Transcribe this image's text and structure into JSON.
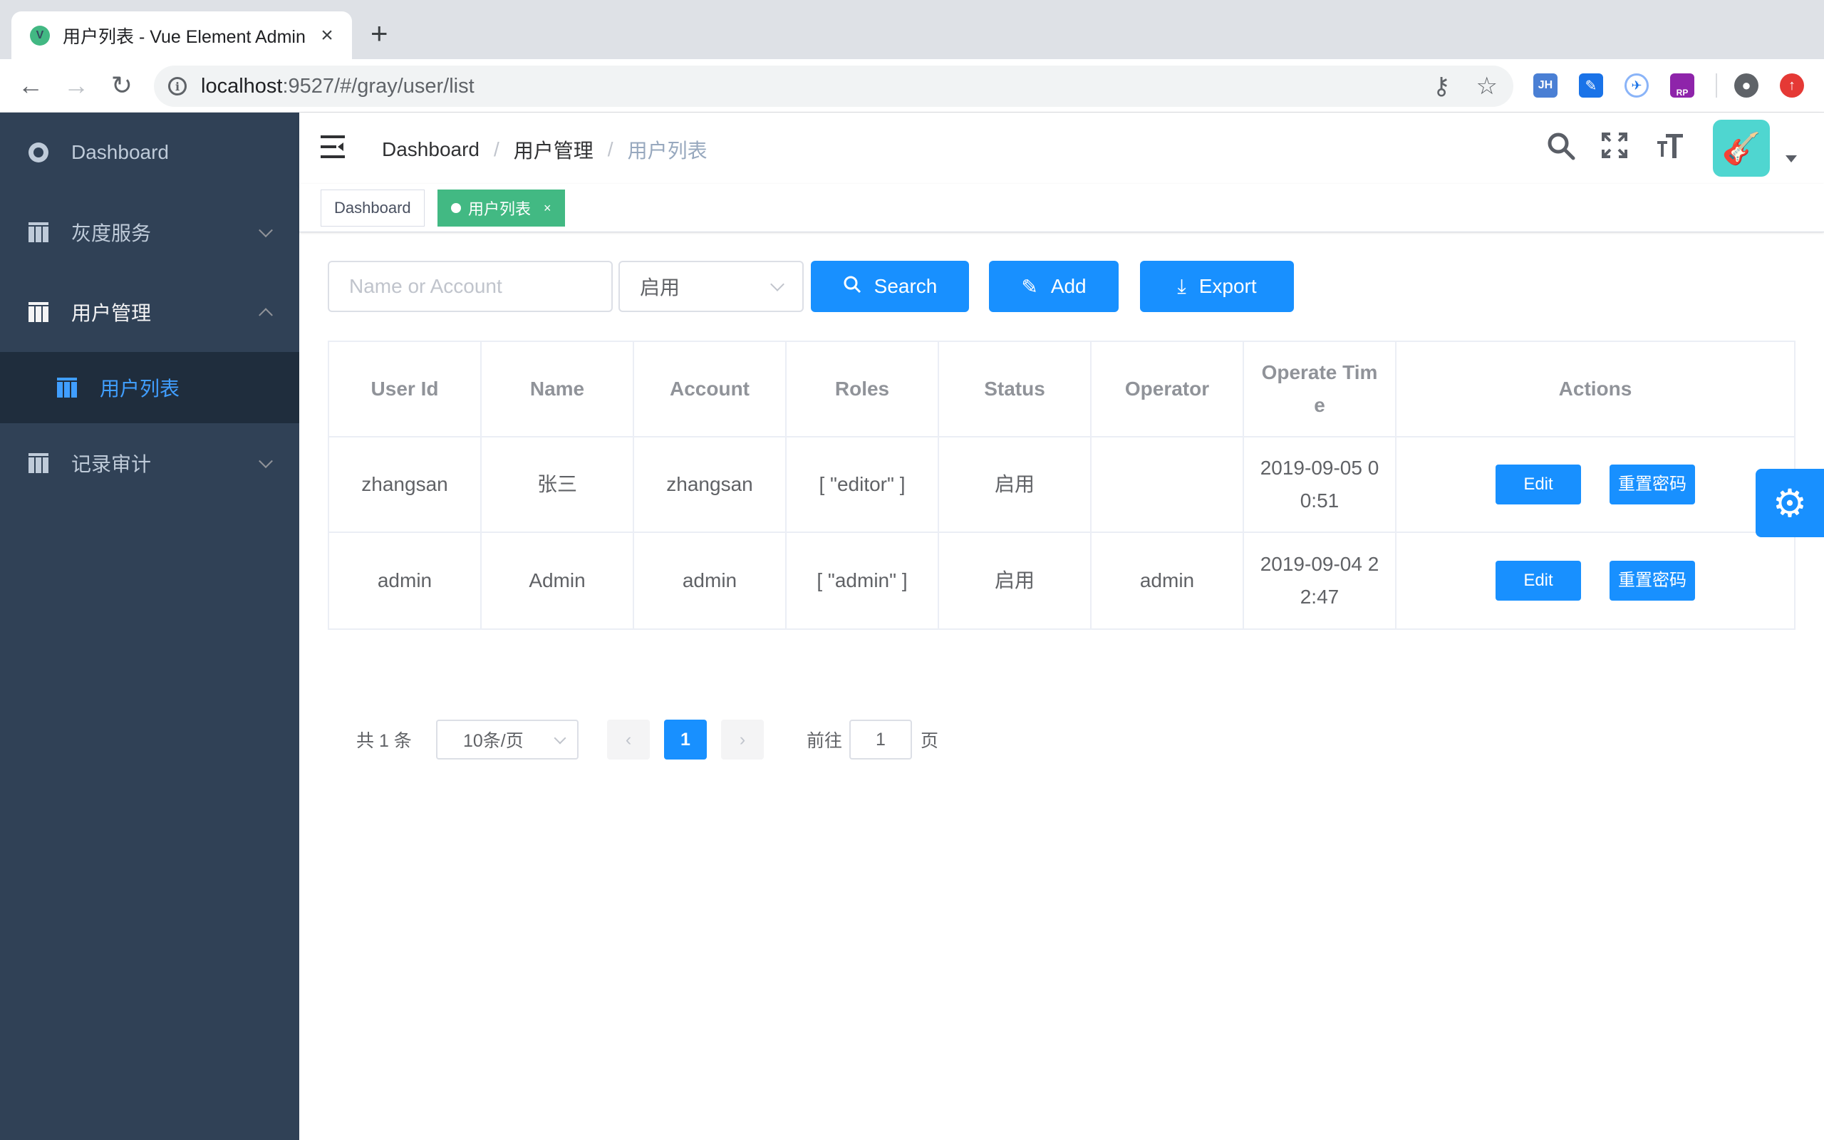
{
  "browser": {
    "tab_title": "用户列表 - Vue Element Admin",
    "favicon_letter": "V",
    "url_host": "localhost",
    "url_rest": ":9527/#/gray/user/list",
    "extensions": [
      "JH",
      "RP"
    ]
  },
  "sidebar": {
    "items": [
      {
        "label": "Dashboard",
        "icon": "dashboard-gauge-icon"
      },
      {
        "label": "灰度服务",
        "icon": "grid-icon",
        "expanded": false
      },
      {
        "label": "用户管理",
        "icon": "grid-icon",
        "expanded": true
      },
      {
        "label": "用户列表",
        "icon": "grid-icon",
        "active": true
      },
      {
        "label": "记录审计",
        "icon": "grid-icon",
        "expanded": false
      }
    ]
  },
  "navbar": {
    "breadcrumb": [
      "Dashboard",
      "用户管理",
      "用户列表"
    ]
  },
  "tags": [
    {
      "label": "Dashboard",
      "active": false
    },
    {
      "label": "用户列表",
      "active": true,
      "close": "×"
    }
  ],
  "filters": {
    "search_placeholder": "Name or Account",
    "status_value": "启用",
    "search_label": "Search",
    "add_label": "Add",
    "export_label": "Export"
  },
  "table": {
    "headers": [
      "User Id",
      "Name",
      "Account",
      "Roles",
      "Status",
      "Operator",
      "Operate Tim\ne",
      "Actions"
    ],
    "rows": [
      {
        "user_id": "zhangsan",
        "name": "张三",
        "account": "zhangsan",
        "roles": "[ \"editor\" ]",
        "status": "启用",
        "operator": "",
        "time": "2019-09-05 0\n0:51",
        "edit": "Edit",
        "reset": "重置密码"
      },
      {
        "user_id": "admin",
        "name": "Admin",
        "account": "admin",
        "roles": "[ \"admin\" ]",
        "status": "启用",
        "operator": "admin",
        "time": "2019-09-04 2\n2:47",
        "edit": "Edit",
        "reset": "重置密码"
      }
    ]
  },
  "pagination": {
    "total": "共 1 条",
    "page_size": "10条/页",
    "current_page": "1",
    "goto_label": "前往",
    "goto_value": "1",
    "page_suffix": "页"
  },
  "colors": {
    "sidebar_bg": "#304156",
    "primary": "#1890ff",
    "tag_active": "#42b983"
  }
}
